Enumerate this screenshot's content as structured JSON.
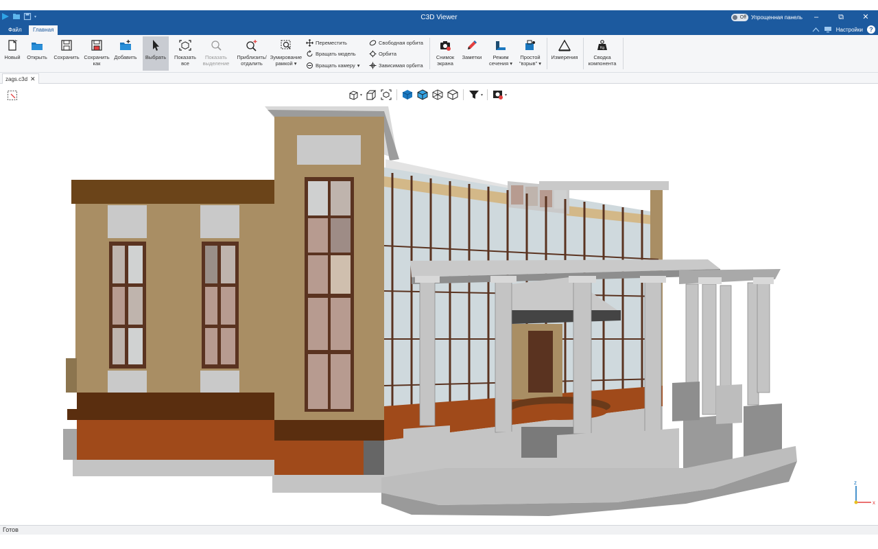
{
  "window": {
    "title": "C3D Viewer",
    "simplified_panel_label": "Упрощенная панель",
    "simplified_panel_toggle": "Off"
  },
  "ribbon_tabs": [
    {
      "label": "Файл",
      "active": false
    },
    {
      "label": "Главная",
      "active": true
    }
  ],
  "settings_label": "Настройки",
  "toolbar": {
    "new": "Новый",
    "open": "Открыть",
    "save": "Сохранить",
    "save_as_1": "Сохранить",
    "save_as_2": "как",
    "add": "Добавить",
    "select": "Выбрать",
    "show_all_1": "Показать",
    "show_all_2": "все",
    "show_selection_1": "Показать",
    "show_selection_2": "выделение",
    "zoom_1": "Приблизить/",
    "zoom_2": "отдалить",
    "zoom_frame_1": "Зумирование",
    "zoom_frame_2": "рамкой",
    "move": "Переместить",
    "rotate_model": "Вращать модель",
    "rotate_camera": "Вращать камеру",
    "free_orbit": "Свободная орбита",
    "orbit": "Орбита",
    "dependent_orbit": "Зависимая орбита",
    "screenshot_1": "Снимок",
    "screenshot_2": "экрана",
    "notes": "Заметки",
    "section_1": "Режим",
    "section_2": "сечения",
    "explode_1": "Простой",
    "explode_2": "\"взрыв\"",
    "measure": "Измерения",
    "summary_1": "Сводка",
    "summary_2": "компонента"
  },
  "document_tab": "zags.c3d",
  "status": "Готов",
  "axes": {
    "x": "x",
    "z": "z"
  },
  "colors": {
    "titlebar": "#1c5a9f",
    "ribbon_bg": "#f5f6f8",
    "wall": "#a98e64",
    "wall_base": "#5a2e0f",
    "wall_plinth": "#a04a1a",
    "glass": "#cfd9dd",
    "column": "#c4c4c4"
  }
}
